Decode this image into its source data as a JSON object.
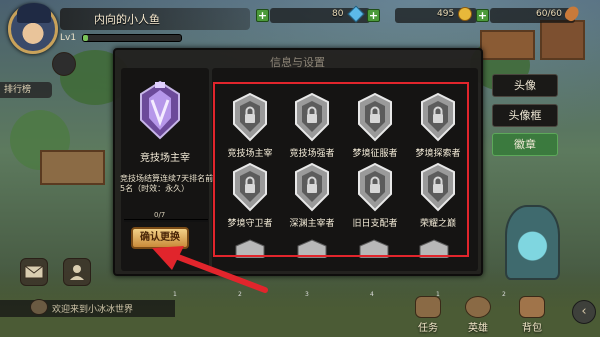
{
  "player": {
    "name": "内向的小人鱼",
    "level_label": "Lv1",
    "level_fraction": 0.05
  },
  "resources": {
    "gems": "80",
    "gold": "495",
    "stamina": "60/60"
  },
  "left_hud": {
    "ranking_tab": "排行榜"
  },
  "dialog": {
    "title": "信息与设置",
    "selected": {
      "name": "竞技场主宰",
      "description": "竞技场结算连续7天排名前5名（时效：永久）",
      "progress_text": "0/7",
      "progress_fraction": 0.0
    },
    "confirm_label": "确认更换",
    "badges": [
      {
        "label": "竞技场主宰"
      },
      {
        "label": "竞技场强者"
      },
      {
        "label": "梦境征服者"
      },
      {
        "label": "梦境探索者"
      },
      {
        "label": "梦境守卫者"
      },
      {
        "label": "深渊主宰者"
      },
      {
        "label": "旧日支配者"
      },
      {
        "label": "荣耀之巅"
      }
    ]
  },
  "tabs": [
    {
      "label": "头像",
      "active": false
    },
    {
      "label": "头像框",
      "active": false
    },
    {
      "label": "徽章",
      "active": true
    }
  ],
  "chat": {
    "message": "欢迎来到小冰冰世界"
  },
  "bottom_nav": [
    {
      "label": "任务"
    },
    {
      "label": "英雄"
    },
    {
      "label": "背包"
    }
  ],
  "page_indicators": [
    "1",
    "2",
    "3",
    "4",
    "1",
    "2"
  ],
  "colors": {
    "highlight_frame": "#e1252c",
    "active_tab": "#3b7a3e",
    "confirm_button": "#e0b062"
  }
}
